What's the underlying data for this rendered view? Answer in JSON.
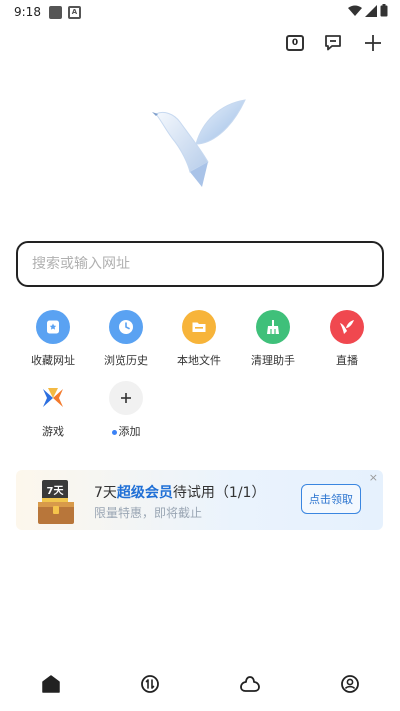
{
  "status_bar": {
    "time": "9:18"
  },
  "header": {
    "tab_count": "0"
  },
  "search": {
    "placeholder": "搜索或输入网址"
  },
  "shortcuts": [
    {
      "label": "收藏网址",
      "color": "#5aa2f2",
      "icon": "bookmark-icon"
    },
    {
      "label": "浏览历史",
      "color": "#5aa2f2",
      "icon": "clock-icon"
    },
    {
      "label": "本地文件",
      "color": "#f7b43a",
      "icon": "folder-icon"
    },
    {
      "label": "清理助手",
      "color": "#3fc07a",
      "icon": "broom-icon"
    },
    {
      "label": "直播",
      "color": "#f0484f",
      "icon": "bird-live-icon"
    },
    {
      "label": "游戏",
      "color": "#3a7ee8",
      "icon": "game-x-icon"
    },
    {
      "label": "添加",
      "color": "#f1f1f1",
      "icon": "plus-icon"
    }
  ],
  "promo": {
    "title_prefix": "7天",
    "title_highlight": "超级会员",
    "title_suffix": "待试用（1/1）",
    "subtitle": "限量特惠，即将截止",
    "button": "点击领取",
    "close": "×",
    "chest_label": "7天"
  },
  "bottom_nav": [
    {
      "icon": "home-icon"
    },
    {
      "icon": "tabs-switch-icon"
    },
    {
      "icon": "cloud-icon"
    },
    {
      "icon": "profile-icon"
    }
  ]
}
